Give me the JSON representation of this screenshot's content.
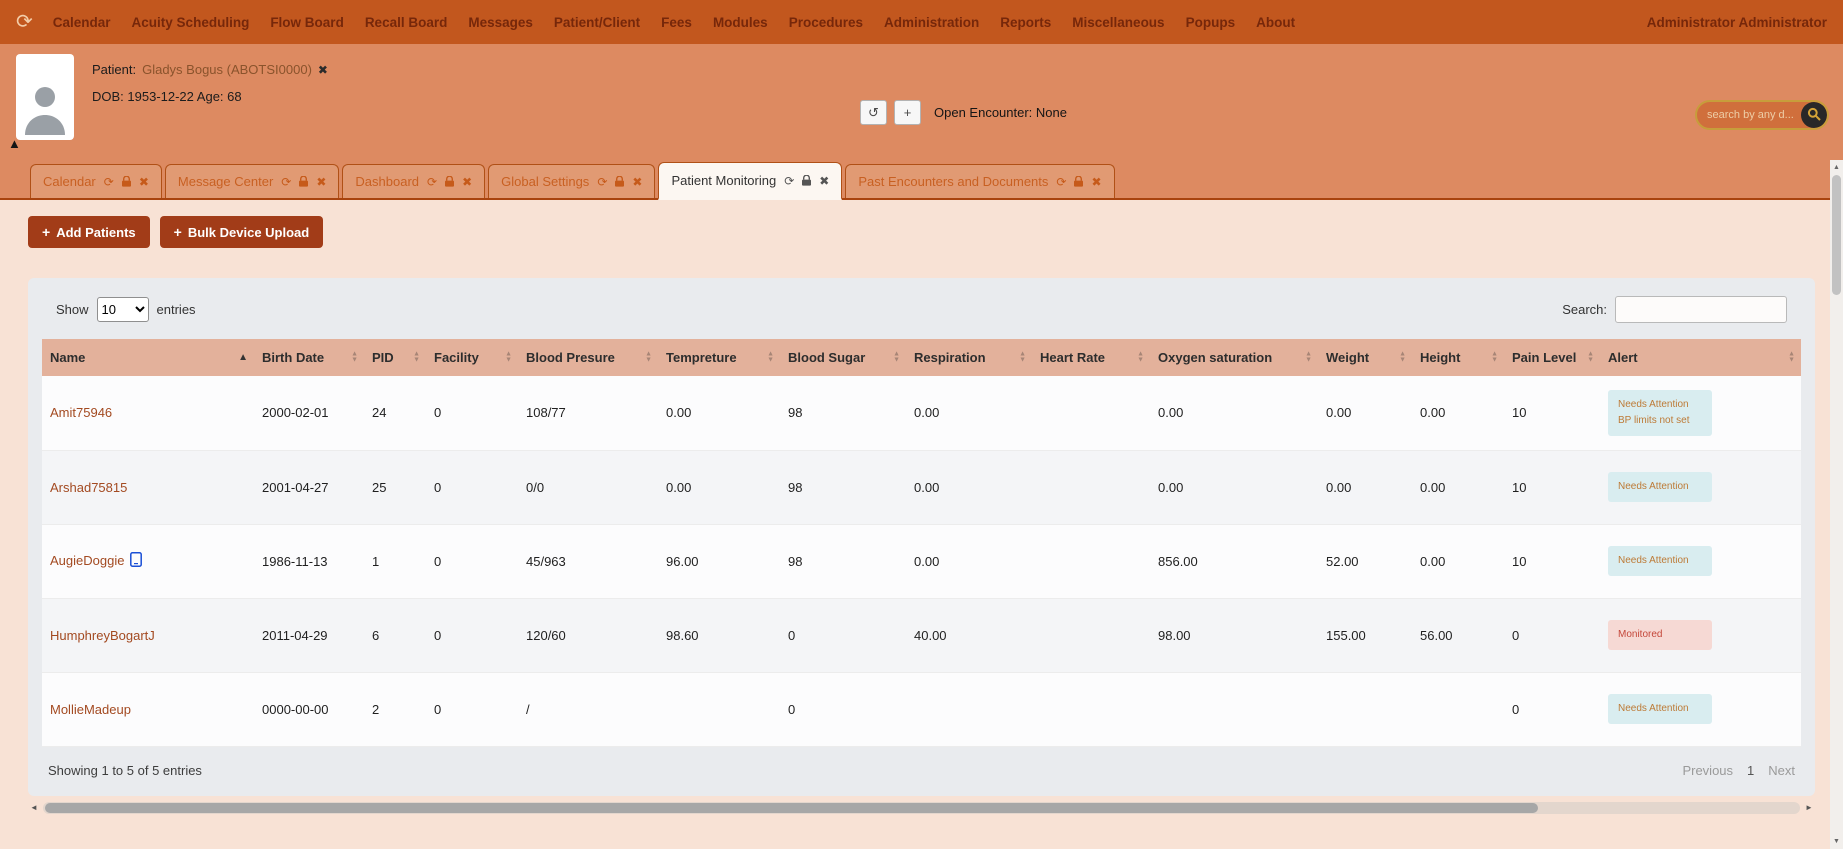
{
  "colors": {
    "nav_bg": "#c2571e",
    "bar_bg": "#dd8a61",
    "tab_inactive_bg": "#e19a73",
    "tab_border": "#b05016",
    "tab_text": "#c65a1a",
    "content_bg": "#f8e2d5",
    "button_bg": "#a23c18",
    "card_bg": "#e9ebee",
    "header_bg": "#e3b19b",
    "link_color": "#a34a21",
    "badge_info_bg": "#d9edf0",
    "badge_info_text": "#bd7a36",
    "badge_danger_bg": "#f6d9d4",
    "badge_danger_text": "#c4473a"
  },
  "icons": {
    "refresh": "⟳",
    "close": "✖",
    "collapse": "▲",
    "history": "↺",
    "plus": "+",
    "sort_asc": "▲",
    "sort_desc": "▼",
    "scroll_left": "◄",
    "scroll_right": "►",
    "scroll_up": "▲",
    "scroll_down": "▼"
  },
  "nav": {
    "items": [
      "Calendar",
      "Acuity Scheduling",
      "Flow Board",
      "Recall Board",
      "Messages",
      "Patient/Client",
      "Fees",
      "Modules",
      "Procedures",
      "Administration",
      "Reports",
      "Miscellaneous",
      "Popups",
      "About"
    ],
    "user": "Administrator Administrator"
  },
  "patient_bar": {
    "patient_label": "Patient:",
    "patient_name": "Gladys Bogus (ABOTSI0000)",
    "dob_line": "DOB: 1953-12-22 Age: 68",
    "open_encounter": "Open Encounter: None",
    "search_placeholder": "search by any d..."
  },
  "tabs": [
    {
      "label": "Calendar",
      "active": false
    },
    {
      "label": "Message Center",
      "active": false
    },
    {
      "label": "Dashboard",
      "active": false
    },
    {
      "label": "Global Settings",
      "active": false
    },
    {
      "label": "Patient Monitoring",
      "active": true
    },
    {
      "label": "Past Encounters and Documents",
      "active": false
    }
  ],
  "toolbar": {
    "add_patients": "Add Patients",
    "bulk_device_upload": "Bulk Device Upload"
  },
  "table": {
    "show_label": "Show",
    "page_size": "10",
    "entries_label": "entries",
    "search_label": "Search:",
    "columns": [
      "Name",
      "Birth Date",
      "PID",
      "Facility",
      "Blood Presure",
      "Tempreture",
      "Blood Sugar",
      "Respiration",
      "Heart Rate",
      "Oxygen saturation",
      "Weight",
      "Height",
      "Pain Level",
      "Alert"
    ],
    "rows": [
      {
        "name": "Amit75946",
        "device": false,
        "cells": [
          "2000-02-01",
          "24",
          "0",
          "108/77",
          "0.00",
          "98",
          "0.00",
          "",
          "0.00",
          "0.00",
          "0.00",
          "10"
        ],
        "alert": {
          "type": "info",
          "lines": [
            "Needs Attention",
            "BP limits not set"
          ]
        }
      },
      {
        "name": "Arshad75815",
        "device": false,
        "cells": [
          "2001-04-27",
          "25",
          "0",
          "0/0",
          "0.00",
          "98",
          "0.00",
          "",
          "0.00",
          "0.00",
          "0.00",
          "10"
        ],
        "alert": {
          "type": "info",
          "lines": [
            "Needs Attention"
          ]
        }
      },
      {
        "name": "AugieDoggie",
        "device": true,
        "cells": [
          "1986-11-13",
          "1",
          "0",
          "45/963",
          "96.00",
          "98",
          "0.00",
          "",
          "856.00",
          "52.00",
          "0.00",
          "10"
        ],
        "alert": {
          "type": "info",
          "lines": [
            "Needs Attention"
          ]
        }
      },
      {
        "name": "HumphreyBogartJ",
        "device": false,
        "cells": [
          "2011-04-29",
          "6",
          "0",
          "120/60",
          "98.60",
          "0",
          "40.00",
          "",
          "98.00",
          "155.00",
          "56.00",
          "0"
        ],
        "alert": {
          "type": "danger",
          "lines": [
            "Monitored"
          ]
        }
      },
      {
        "name": "MollieMadeup",
        "device": false,
        "cells": [
          "0000-00-00",
          "2",
          "0",
          "/",
          "",
          "0",
          "",
          "",
          "",
          "",
          "",
          "0"
        ],
        "alert": {
          "type": "info",
          "lines": [
            "Needs Attention"
          ]
        }
      }
    ],
    "footer": "Showing 1 to 5 of 5 entries",
    "pagination": {
      "previous": "Previous",
      "page": "1",
      "next": "Next"
    }
  }
}
